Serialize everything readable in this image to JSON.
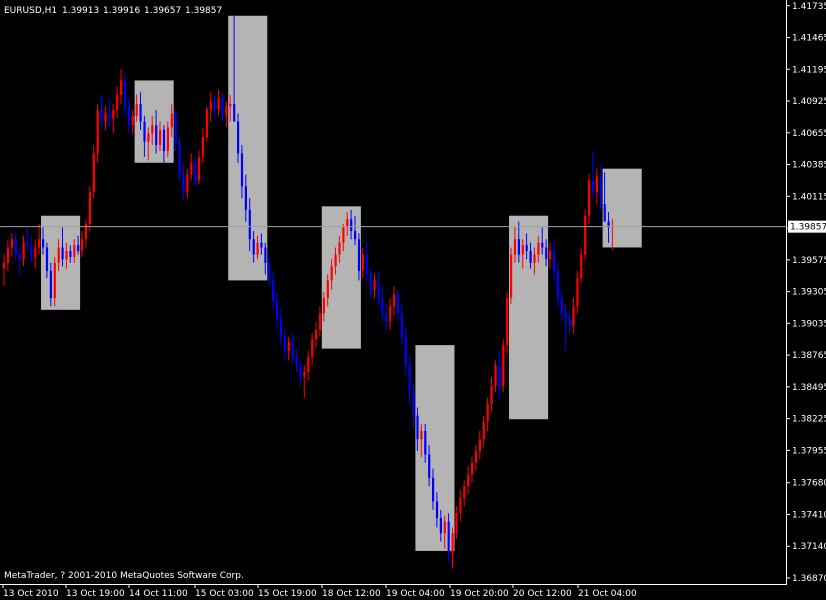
{
  "header": {
    "symbol": "EURUSD,H1",
    "open": "1.39913",
    "high": "1.39916",
    "low": "1.39657",
    "close": "1.39857"
  },
  "footer": {
    "copyright": "MetaTrader, ? 2001-2010 MetaQuotes Software Corp."
  },
  "chart_data": {
    "type": "candlestick",
    "symbol": "EURUSD",
    "timeframe": "H1",
    "ylim": [
      1.3687,
      1.4175
    ],
    "y_ticks": [
      "1.41735",
      "1.41465",
      "1.41195",
      "1.40925",
      "1.40655",
      "1.40385",
      "1.40115",
      "1.39845",
      "1.39575",
      "1.39305",
      "1.39035",
      "1.38765",
      "1.38495",
      "1.38225",
      "1.37955",
      "1.37680",
      "1.37410",
      "1.37140",
      "1.36870"
    ],
    "x_ticks": [
      "13 Oct 2010",
      "13 Oct 19:00",
      "14 Oct 11:00",
      "15 Oct 03:00",
      "15 Oct 19:00",
      "18 Oct 12:00",
      "19 Oct 04:00",
      "19 Oct 20:00",
      "20 Oct 12:00",
      "21 Oct 04:00"
    ],
    "current_price": "1.39857",
    "grid": false,
    "colors": {
      "background": "#000000",
      "bull": "#ff0000",
      "bear": "#0000ff",
      "box": "#b4b4b4",
      "price_line": "#a0a0a0",
      "axis": "#ffffff"
    },
    "session_boxes": [
      {
        "start": 10,
        "end": 19,
        "high": 1.3995,
        "low": 1.3915
      },
      {
        "start": 34,
        "end": 43,
        "high": 1.411,
        "low": 1.404
      },
      {
        "start": 58,
        "end": 67,
        "high": 1.4165,
        "low": 1.394
      },
      {
        "start": 82,
        "end": 91,
        "high": 1.4003,
        "low": 1.3882
      },
      {
        "start": 106,
        "end": 115,
        "high": 1.3885,
        "low": 1.371
      },
      {
        "start": 130,
        "end": 139,
        "high": 1.3995,
        "low": 1.3822
      },
      {
        "start": 154,
        "end": 163,
        "high": 1.4035,
        "low": 1.3968
      }
    ],
    "candles": [
      [
        1.395,
        1.3962,
        1.3935,
        1.3955
      ],
      [
        1.3955,
        1.3975,
        1.3948,
        1.3968
      ],
      [
        1.3968,
        1.398,
        1.396,
        1.3975
      ],
      [
        1.3975,
        1.3982,
        1.3958,
        1.3962
      ],
      [
        1.3962,
        1.3968,
        1.3945,
        1.3958
      ],
      [
        1.3958,
        1.3978,
        1.3952,
        1.3972
      ],
      [
        1.3972,
        1.3985,
        1.3965,
        1.397
      ],
      [
        1.397,
        1.3978,
        1.3955,
        1.396
      ],
      [
        1.396,
        1.3975,
        1.395,
        1.3968
      ],
      [
        1.3968,
        1.3988,
        1.3962,
        1.3975
      ],
      [
        1.3975,
        1.3985,
        1.3962,
        1.3968
      ],
      [
        1.3968,
        1.3972,
        1.3942,
        1.3948
      ],
      [
        1.3948,
        1.3955,
        1.3918,
        1.3925
      ],
      [
        1.3925,
        1.396,
        1.3918,
        1.3955
      ],
      [
        1.3955,
        1.3975,
        1.3948,
        1.3968
      ],
      [
        1.3968,
        1.3985,
        1.3952,
        1.3958
      ],
      [
        1.3958,
        1.3972,
        1.395,
        1.3965
      ],
      [
        1.3965,
        1.397,
        1.3955,
        1.396
      ],
      [
        1.396,
        1.3975,
        1.3955,
        1.397
      ],
      [
        1.397,
        1.3978,
        1.3962,
        1.3965
      ],
      [
        1.3965,
        1.3982,
        1.396,
        1.3975
      ],
      [
        1.3975,
        1.3992,
        1.3968,
        1.3988
      ],
      [
        1.3988,
        1.402,
        1.3982,
        1.4015
      ],
      [
        1.4015,
        1.4055,
        1.401,
        1.4048
      ],
      [
        1.4048,
        1.409,
        1.404,
        1.4085
      ],
      [
        1.4085,
        1.4098,
        1.4068,
        1.4075
      ],
      [
        1.4075,
        1.4088,
        1.4068,
        1.4082
      ],
      [
        1.4082,
        1.4095,
        1.407,
        1.4078
      ],
      [
        1.4078,
        1.409,
        1.4065,
        1.4085
      ],
      [
        1.4085,
        1.4105,
        1.4078,
        1.4098
      ],
      [
        1.4098,
        1.412,
        1.409,
        1.411
      ],
      [
        1.411,
        1.4115,
        1.408,
        1.4088
      ],
      [
        1.4088,
        1.4095,
        1.4065,
        1.4072
      ],
      [
        1.4072,
        1.4085,
        1.4065,
        1.408
      ],
      [
        1.408,
        1.4098,
        1.4075,
        1.409
      ],
      [
        1.409,
        1.41,
        1.4068,
        1.4075
      ],
      [
        1.4075,
        1.408,
        1.4045,
        1.4058
      ],
      [
        1.4058,
        1.407,
        1.4042,
        1.4065
      ],
      [
        1.4065,
        1.408,
        1.4055,
        1.4072
      ],
      [
        1.4072,
        1.4085,
        1.4048,
        1.4055
      ],
      [
        1.4055,
        1.4075,
        1.405,
        1.4068
      ],
      [
        1.4068,
        1.4072,
        1.404,
        1.405
      ],
      [
        1.405,
        1.4075,
        1.4045,
        1.407
      ],
      [
        1.407,
        1.409,
        1.4062,
        1.4082
      ],
      [
        1.4082,
        1.4085,
        1.405,
        1.4058
      ],
      [
        1.4058,
        1.4062,
        1.4025,
        1.403
      ],
      [
        1.403,
        1.4038,
        1.4008,
        1.4015
      ],
      [
        1.4015,
        1.4035,
        1.401,
        1.403
      ],
      [
        1.403,
        1.4048,
        1.4025,
        1.404
      ],
      [
        1.404,
        1.4045,
        1.402,
        1.4025
      ],
      [
        1.4025,
        1.405,
        1.4022,
        1.4045
      ],
      [
        1.4045,
        1.407,
        1.404,
        1.4062
      ],
      [
        1.4062,
        1.4088,
        1.4058,
        1.4085
      ],
      [
        1.4085,
        1.41,
        1.4075,
        1.4092
      ],
      [
        1.4092,
        1.4098,
        1.4078,
        1.4085
      ],
      [
        1.4085,
        1.4102,
        1.408,
        1.4095
      ],
      [
        1.4095,
        1.41,
        1.4075,
        1.408
      ],
      [
        1.408,
        1.4092,
        1.407,
        1.4088
      ],
      [
        1.4088,
        1.4098,
        1.4075,
        1.409
      ],
      [
        1.409,
        1.4165,
        1.4085,
        1.4075
      ],
      [
        1.4075,
        1.4082,
        1.404,
        1.4048
      ],
      [
        1.4048,
        1.4055,
        1.401,
        1.402
      ],
      [
        1.402,
        1.403,
        1.399,
        1.4
      ],
      [
        1.4,
        1.401,
        1.3965,
        1.3975
      ],
      [
        1.3975,
        1.3982,
        1.3955,
        1.3962
      ],
      [
        1.3962,
        1.3978,
        1.3958,
        1.3972
      ],
      [
        1.3972,
        1.398,
        1.3962,
        1.3968
      ],
      [
        1.3968,
        1.3972,
        1.3945,
        1.3955
      ],
      [
        1.3955,
        1.396,
        1.3935,
        1.394
      ],
      [
        1.394,
        1.3948,
        1.3915,
        1.3922
      ],
      [
        1.3922,
        1.393,
        1.39,
        1.3908
      ],
      [
        1.3908,
        1.3915,
        1.3885,
        1.3892
      ],
      [
        1.3892,
        1.3898,
        1.3872,
        1.388
      ],
      [
        1.388,
        1.3892,
        1.3872,
        1.3888
      ],
      [
        1.3888,
        1.3895,
        1.387,
        1.3875
      ],
      [
        1.3875,
        1.3882,
        1.3862,
        1.3868
      ],
      [
        1.3868,
        1.3872,
        1.385,
        1.3858
      ],
      [
        1.3858,
        1.3868,
        1.384,
        1.3862
      ],
      [
        1.3862,
        1.388,
        1.3855,
        1.3875
      ],
      [
        1.3875,
        1.3895,
        1.3868,
        1.389
      ],
      [
        1.389,
        1.3905,
        1.3882,
        1.3898
      ],
      [
        1.3898,
        1.3918,
        1.3892,
        1.3912
      ],
      [
        1.3912,
        1.393,
        1.3905,
        1.3925
      ],
      [
        1.3925,
        1.3945,
        1.3918,
        1.394
      ],
      [
        1.394,
        1.3958,
        1.3932,
        1.3952
      ],
      [
        1.3952,
        1.3968,
        1.3945,
        1.3962
      ],
      [
        1.3962,
        1.3978,
        1.3955,
        1.3972
      ],
      [
        1.3972,
        1.3988,
        1.3965,
        1.3985
      ],
      [
        1.3985,
        1.3998,
        1.3978,
        1.3992
      ],
      [
        1.3992,
        1.4,
        1.3975,
        1.3982
      ],
      [
        1.3982,
        1.3995,
        1.397,
        1.3975
      ],
      [
        1.3975,
        1.398,
        1.394,
        1.3948
      ],
      [
        1.3948,
        1.3968,
        1.3942,
        1.3962
      ],
      [
        1.3962,
        1.3972,
        1.394,
        1.3945
      ],
      [
        1.3945,
        1.395,
        1.3925,
        1.3932
      ],
      [
        1.3932,
        1.3945,
        1.3925,
        1.394
      ],
      [
        1.394,
        1.3948,
        1.3918,
        1.3925
      ],
      [
        1.3925,
        1.3935,
        1.3905,
        1.3912
      ],
      [
        1.3912,
        1.392,
        1.3898,
        1.3905
      ],
      [
        1.3905,
        1.3925,
        1.3898,
        1.3918
      ],
      [
        1.3918,
        1.3935,
        1.391,
        1.3928
      ],
      [
        1.3928,
        1.3932,
        1.3905,
        1.3912
      ],
      [
        1.3912,
        1.392,
        1.3885,
        1.3892
      ],
      [
        1.3892,
        1.39,
        1.386,
        1.3868
      ],
      [
        1.3868,
        1.3875,
        1.3835,
        1.3845
      ],
      [
        1.3845,
        1.3852,
        1.3815,
        1.3825
      ],
      [
        1.3825,
        1.3832,
        1.3795,
        1.3805
      ],
      [
        1.3805,
        1.3818,
        1.379,
        1.3812
      ],
      [
        1.3812,
        1.3818,
        1.3785,
        1.3792
      ],
      [
        1.3792,
        1.38,
        1.3765,
        1.3772
      ],
      [
        1.3772,
        1.378,
        1.3745,
        1.3752
      ],
      [
        1.3752,
        1.376,
        1.373,
        1.3738
      ],
      [
        1.3738,
        1.3745,
        1.3718,
        1.3725
      ],
      [
        1.3725,
        1.374,
        1.3712,
        1.3735
      ],
      [
        1.3735,
        1.3742,
        1.37,
        1.3708
      ],
      [
        1.3708,
        1.373,
        1.3695,
        1.3725
      ],
      [
        1.3725,
        1.3748,
        1.372,
        1.3742
      ],
      [
        1.3742,
        1.3762,
        1.3735,
        1.3755
      ],
      [
        1.3755,
        1.377,
        1.3748,
        1.3765
      ],
      [
        1.3765,
        1.3782,
        1.3758,
        1.3775
      ],
      [
        1.3775,
        1.379,
        1.3768,
        1.3785
      ],
      [
        1.3785,
        1.38,
        1.3778,
        1.3795
      ],
      [
        1.3795,
        1.3812,
        1.3788,
        1.3805
      ],
      [
        1.3805,
        1.3825,
        1.3798,
        1.382
      ],
      [
        1.382,
        1.384,
        1.3812,
        1.3835
      ],
      [
        1.3835,
        1.3858,
        1.3828,
        1.385
      ],
      [
        1.385,
        1.3872,
        1.3845,
        1.3868
      ],
      [
        1.3868,
        1.388,
        1.384,
        1.385
      ],
      [
        1.385,
        1.389,
        1.3845,
        1.3885
      ],
      [
        1.3885,
        1.393,
        1.3878,
        1.3925
      ],
      [
        1.3925,
        1.3968,
        1.392,
        1.3962
      ],
      [
        1.3962,
        1.3985,
        1.3955,
        1.3975
      ],
      [
        1.3975,
        1.399,
        1.3955,
        1.3962
      ],
      [
        1.3962,
        1.3975,
        1.395,
        1.397
      ],
      [
        1.397,
        1.398,
        1.3958,
        1.3965
      ],
      [
        1.3965,
        1.3972,
        1.395,
        1.3955
      ],
      [
        1.3955,
        1.3968,
        1.3945,
        1.3962
      ],
      [
        1.3962,
        1.3978,
        1.3955,
        1.3972
      ],
      [
        1.3972,
        1.3985,
        1.3962,
        1.3968
      ],
      [
        1.3968,
        1.3975,
        1.3952,
        1.3958
      ],
      [
        1.3958,
        1.3972,
        1.395,
        1.3965
      ],
      [
        1.3965,
        1.3975,
        1.394,
        1.3948
      ],
      [
        1.3948,
        1.3955,
        1.3918,
        1.3925
      ],
      [
        1.3925,
        1.3932,
        1.3905,
        1.3912
      ],
      [
        1.3912,
        1.392,
        1.388,
        1.3908
      ],
      [
        1.3908,
        1.3915,
        1.3895,
        1.3902
      ],
      [
        1.3902,
        1.3925,
        1.3895,
        1.3918
      ],
      [
        1.3918,
        1.3948,
        1.3912,
        1.3942
      ],
      [
        1.3942,
        1.3968,
        1.3938,
        1.3962
      ],
      [
        1.3962,
        1.4,
        1.3958,
        1.3995
      ],
      [
        1.3995,
        1.403,
        1.3988,
        1.4025
      ],
      [
        1.4025,
        1.405,
        1.401,
        1.4015
      ],
      [
        1.4015,
        1.4035,
        1.4005,
        1.4028
      ],
      [
        1.4028,
        1.4038,
        1.4,
        1.4005
      ],
      [
        1.4005,
        1.4032,
        1.3998,
        1.399
      ],
      [
        1.399,
        1.3998,
        1.3972,
        1.3985
      ],
      [
        1.3985,
        1.3992,
        1.3966,
        1.3986
      ]
    ]
  }
}
